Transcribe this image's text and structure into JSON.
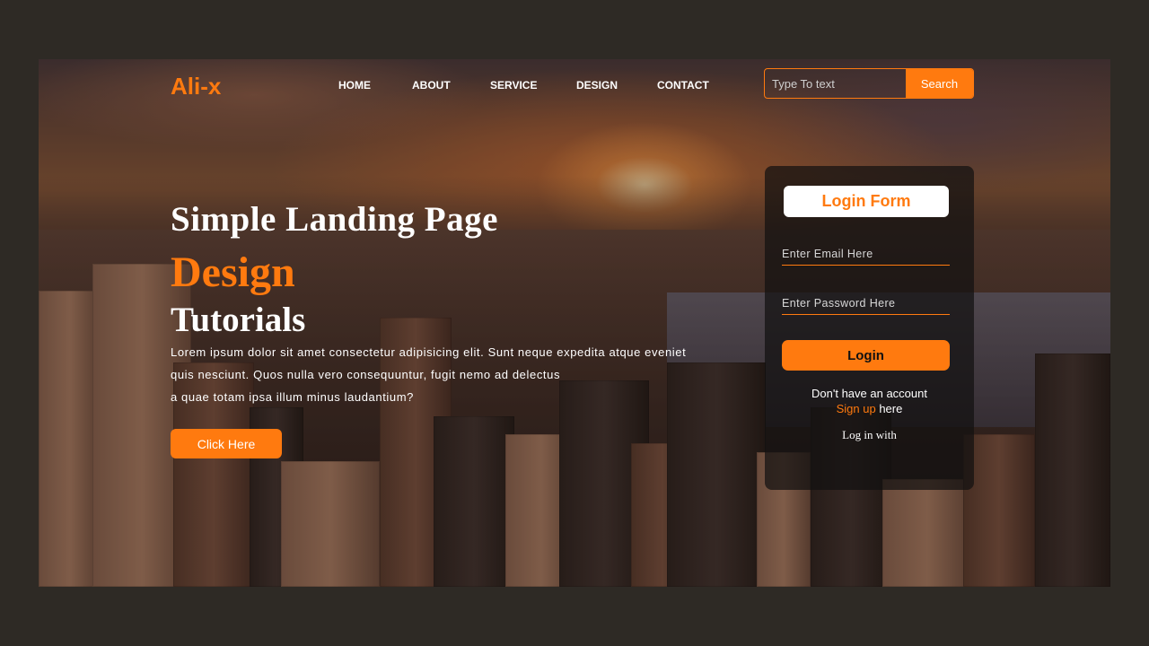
{
  "header": {
    "logo": "Ali-x",
    "nav": [
      "HOME",
      "ABOUT",
      "SERVICE",
      "DESIGN",
      "CONTACT"
    ],
    "search": {
      "placeholder": "Type To text",
      "button_label": "Search"
    }
  },
  "hero": {
    "title_line1": "Simple Landing Page",
    "title_line2": "Design",
    "title_line3": "Tutorials",
    "paragraph": [
      "Lorem ipsum dolor sit amet consectetur adipisicing elit. Sunt neque expedita atque eveniet",
      "quis nesciunt. Quos nulla vero consequuntur, fugit nemo ad delectus",
      "a quae totam ipsa illum minus laudantium?"
    ],
    "cta_label": "Click Here"
  },
  "login": {
    "title": "Login Form",
    "email_placeholder": "Enter Email Here",
    "password_placeholder": "Enter Password Here",
    "button_label": "Login",
    "no_account_text": "Don't have an account",
    "signup_link": "Sign up",
    "signup_suffix": " here",
    "login_with": "Log in with"
  },
  "colors": {
    "accent": "#ff7a0f",
    "page_bg": "#2e2a25"
  }
}
